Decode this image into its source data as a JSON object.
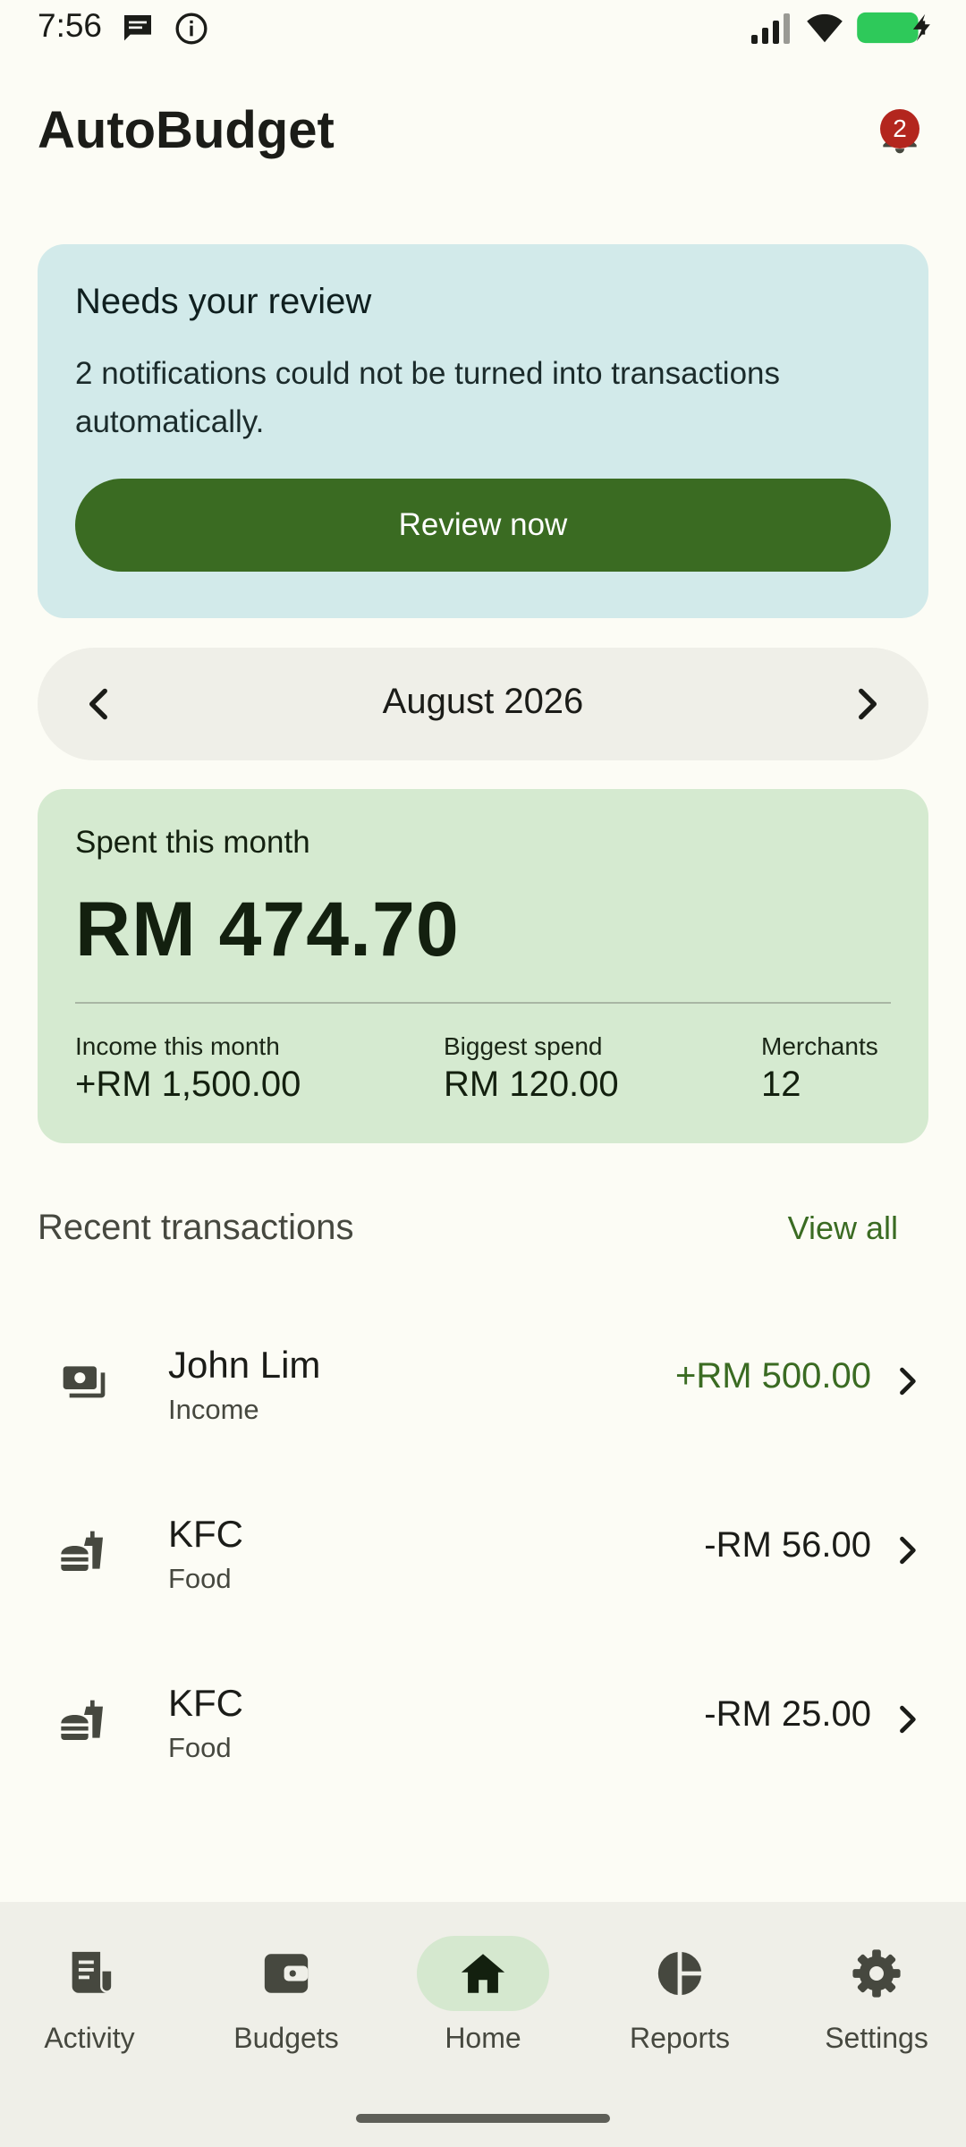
{
  "status_bar": {
    "time": "7:56",
    "icons": [
      "message-icon",
      "info-icon",
      "signal-icon",
      "wifi-icon",
      "battery-charging-icon"
    ]
  },
  "header": {
    "title": "AutoBudget",
    "notification_count": "2"
  },
  "review_card": {
    "title": "Needs your review",
    "text": "2 notifications could not be turned into transactions automatically.",
    "button_label": "Review now"
  },
  "month_selector": {
    "label": "August 2026"
  },
  "summary": {
    "spent_label": "Spent this month",
    "spent_value": "RM 474.70",
    "income_label": "Income this month",
    "income_value": "+RM 1,500.00",
    "biggest_label": "Biggest spend",
    "biggest_value": "RM 120.00",
    "merchants_label": "Merchants",
    "merchants_value": "12"
  },
  "recent": {
    "title": "Recent transactions",
    "view_all": "View all",
    "items": [
      {
        "name": "John Lim",
        "category": "Income",
        "amount": "+RM 500.00",
        "icon": "payments-icon"
      },
      {
        "name": "KFC",
        "category": "Food",
        "amount": "-RM 56.00",
        "icon": "fastfood-icon"
      },
      {
        "name": "KFC",
        "category": "Food",
        "amount": "-RM 25.00",
        "icon": "fastfood-icon"
      }
    ]
  },
  "nav": {
    "items": [
      {
        "label": "Activity",
        "icon": "receipt-icon"
      },
      {
        "label": "Budgets",
        "icon": "wallet-icon"
      },
      {
        "label": "Home",
        "icon": "home-icon",
        "active": true
      },
      {
        "label": "Reports",
        "icon": "pie-chart-icon"
      },
      {
        "label": "Settings",
        "icon": "gear-icon"
      }
    ]
  },
  "colors": {
    "background": "#fcfcf5",
    "accent_green": "#3a6b22",
    "review_card_bg": "#d2eaea",
    "summary_card_bg": "#d5ead0",
    "badge_red": "#b3261e"
  }
}
